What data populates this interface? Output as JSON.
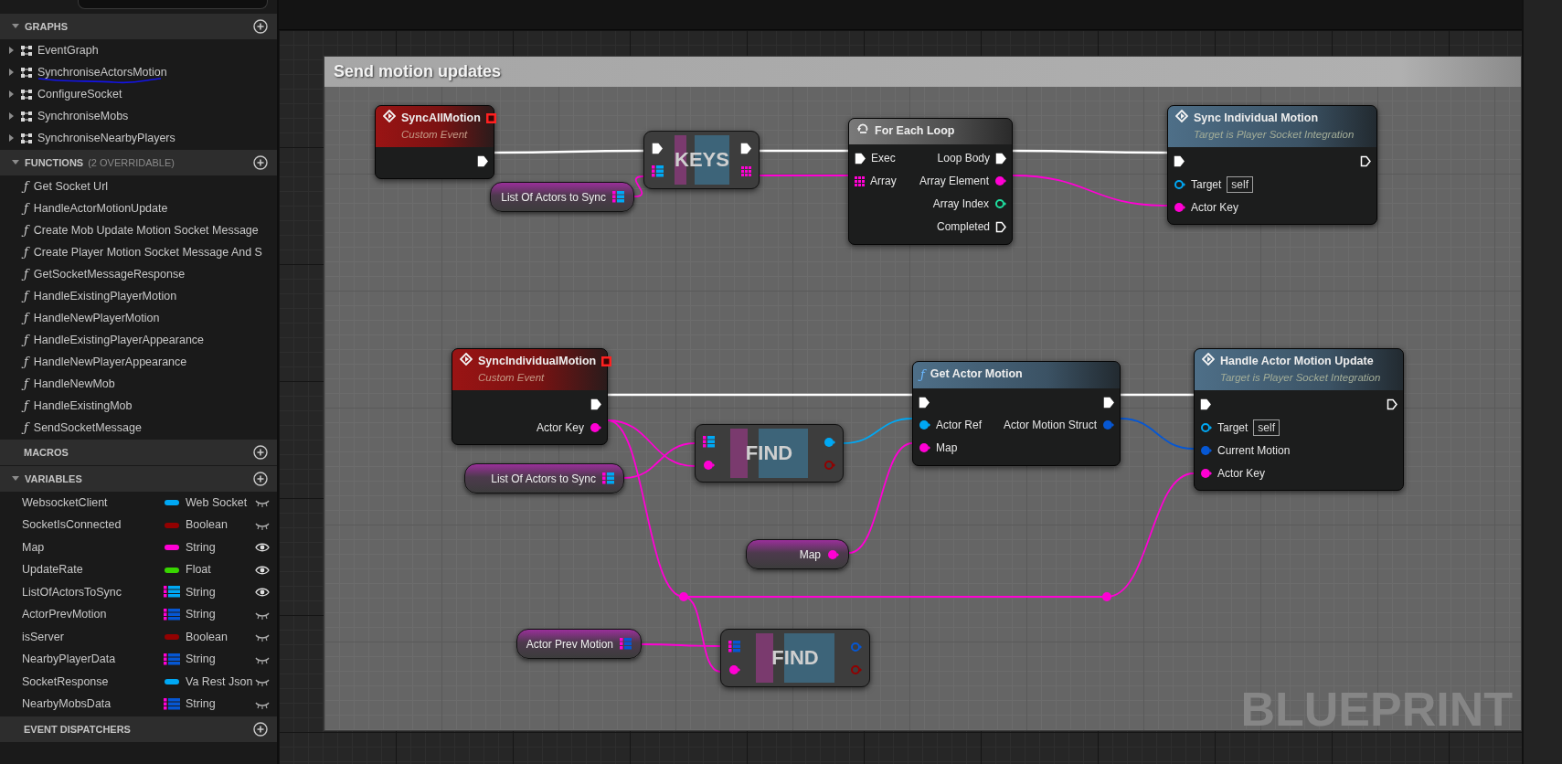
{
  "sidebar": {
    "sections": [
      {
        "kind": "graphs",
        "title": "GRAPHS",
        "expanded": true,
        "items": [
          {
            "label": "EventGraph",
            "expanded": false,
            "underlined": false
          },
          {
            "label": "SynchroniseActorsMotion",
            "expanded": false,
            "underlined": true
          },
          {
            "label": "ConfigureSocket",
            "expanded": false,
            "underlined": false
          },
          {
            "label": "SynchroniseMobs",
            "expanded": false,
            "underlined": false
          },
          {
            "label": "SynchroniseNearbyPlayers",
            "expanded": false,
            "underlined": false
          }
        ]
      },
      {
        "kind": "functions",
        "title": "FUNCTIONS",
        "note": "(2 OVERRIDABLE)",
        "expanded": true,
        "items": [
          {
            "icon": "ƒ",
            "label": "Get Socket Url"
          },
          {
            "icon": "ƒ",
            "label": "HandleActorMotionUpdate"
          },
          {
            "icon": "ƒ",
            "label": "Create Mob Update Motion Socket Message"
          },
          {
            "icon": "ƒ",
            "label": "Create Player Motion Socket Message And S"
          },
          {
            "icon": "ƒ",
            "label": "GetSocketMessageResponse"
          },
          {
            "icon": "ƒ",
            "label": "HandleExistingPlayerMotion"
          },
          {
            "icon": "ƒ",
            "label": "HandleNewPlayerMotion"
          },
          {
            "icon": "ƒ",
            "label": "HandleExistingPlayerAppearance"
          },
          {
            "icon": "ƒ",
            "label": "HandleNewPlayerAppearance"
          },
          {
            "icon": "ƒ",
            "label": "HandleNewMob"
          },
          {
            "icon": "ƒ",
            "label": "HandleExistingMob"
          },
          {
            "icon": "ƒ",
            "label": "SendSocketMessage"
          }
        ]
      },
      {
        "title": "MACROS"
      },
      {
        "kind": "variables",
        "title": "VARIABLES",
        "expanded": true,
        "items": [
          {
            "name": "WebsocketClient",
            "type": "Web Socket",
            "kind": "single",
            "color": "#00a8f4",
            "visible": false
          },
          {
            "name": "SocketIsConnected",
            "type": "Boolean",
            "kind": "single",
            "color": "#920101",
            "visible": false
          },
          {
            "name": "Map",
            "type": "String",
            "kind": "single",
            "color": "#ff00d4",
            "visible": true
          },
          {
            "name": "UpdateRate",
            "type": "Float",
            "kind": "single",
            "color": "#38d500",
            "visible": true
          },
          {
            "name": "ListOfActorsToSync",
            "type": "String",
            "kind": "map",
            "color": "#00a8f4",
            "visible": true
          },
          {
            "name": "ActorPrevMotion",
            "type": "String",
            "kind": "map",
            "color": "#0657d3",
            "visible": false
          },
          {
            "name": "isServer",
            "type": "Boolean",
            "kind": "single",
            "color": "#920101",
            "visible": false
          },
          {
            "name": "NearbyPlayerData",
            "type": "String",
            "kind": "map",
            "color": "#0657d3",
            "visible": false
          },
          {
            "name": "SocketResponse",
            "type": "Va Rest Json",
            "kind": "single",
            "color": "#00a8f4",
            "visible": false
          },
          {
            "name": "NearbyMobsData",
            "type": "String",
            "kind": "map",
            "color": "#0657d3",
            "visible": false
          }
        ]
      },
      {
        "title": "EVENT DISPATCHERS"
      }
    ]
  },
  "graph": {
    "comment": {
      "title": "Send motion updates"
    },
    "watermark": "BLUEPRINT",
    "nodes": [
      {
        "kind": "event",
        "title": "SyncAllMotion",
        "subtitle": "Custom Event",
        "header_pin": {
          "kind": "delegate",
          "color": "#ff2020",
          "linked": false
        },
        "outputs": [
          {
            "kind": "exec",
            "linked": true
          }
        ]
      },
      {
        "kind": "compact",
        "title": "KEYS",
        "inputs": [
          {
            "kind": "exec",
            "linked": true
          },
          {
            "kind": "map",
            "color": "#00a8f4",
            "linked": true
          }
        ],
        "outputs": [
          {
            "kind": "exec",
            "linked": true
          },
          {
            "kind": "array",
            "color": "#ff00d4",
            "linked": true
          }
        ]
      },
      {
        "kind": "variable",
        "title": "List Of Actors to Sync",
        "outputs": [
          {
            "kind": "map",
            "color": "#00a8f4",
            "linked": true
          }
        ]
      },
      {
        "kind": "macro",
        "title": "For Each Loop",
        "inputs": [
          {
            "kind": "exec",
            "label": "Exec",
            "linked": true
          },
          {
            "kind": "array",
            "label": "Array",
            "color": "#ff00d4",
            "linked": true
          }
        ],
        "outputs": [
          {
            "kind": "exec",
            "label": "Loop Body",
            "linked": true
          },
          {
            "kind": "data",
            "label": "Array Element",
            "color": "#ff00d4",
            "linked": true
          },
          {
            "kind": "data",
            "label": "Array Index",
            "color": "#1fe0a0",
            "linked": false
          },
          {
            "kind": "exec",
            "label": "Completed",
            "linked": false
          }
        ]
      },
      {
        "kind": "function",
        "title": "Sync Individual Motion",
        "subtitle": "Target is Player Socket Integration",
        "inputs": [
          {
            "kind": "exec",
            "linked": true
          },
          {
            "kind": "data",
            "label": "Target",
            "value": "self",
            "color": "#00a8f4",
            "linked": false
          },
          {
            "kind": "data",
            "label": "Actor Key",
            "color": "#ff00d4",
            "linked": true
          }
        ],
        "outputs": [
          {
            "kind": "exec",
            "linked": false
          }
        ]
      },
      {
        "kind": "event",
        "title": "SyncIndividualMotion",
        "subtitle": "Custom Event",
        "header_pin": {
          "kind": "delegate",
          "color": "#ff2020",
          "linked": false
        },
        "outputs": [
          {
            "kind": "exec",
            "linked": true
          },
          {
            "kind": "data",
            "label": "Actor Key",
            "color": "#ff00d4",
            "linked": true
          }
        ]
      },
      {
        "kind": "variable",
        "title": "List Of Actors to Sync",
        "outputs": [
          {
            "kind": "map",
            "color": "#00a8f4",
            "linked": true
          }
        ]
      },
      {
        "kind": "compact",
        "title": "FIND",
        "inputs": [
          {
            "kind": "map",
            "color": "#00a8f4",
            "linked": true
          },
          {
            "kind": "data",
            "color": "#ff00d4",
            "linked": true
          }
        ],
        "outputs": [
          {
            "kind": "data",
            "color": "#00a8f4",
            "linked": true
          },
          {
            "kind": "data",
            "color": "#920101",
            "linked": false
          }
        ]
      },
      {
        "kind": "function",
        "title": "Get Actor Motion",
        "glyph": "ƒ",
        "inputs": [
          {
            "kind": "exec",
            "linked": true
          },
          {
            "kind": "data",
            "label": "Actor Ref",
            "color": "#00a8f4",
            "linked": true
          },
          {
            "kind": "data",
            "label": "Map",
            "color": "#ff00d4",
            "linked": true
          }
        ],
        "outputs": [
          {
            "kind": "exec",
            "linked": true
          },
          {
            "kind": "data",
            "label": "Actor Motion Struct",
            "color": "#0657d3",
            "linked": true
          }
        ]
      },
      {
        "kind": "function",
        "title": "Handle Actor Motion Update",
        "subtitle": "Target is Player Socket Integration",
        "inputs": [
          {
            "kind": "exec",
            "linked": true
          },
          {
            "kind": "data",
            "label": "Target",
            "value": "self",
            "color": "#00a8f4",
            "linked": false
          },
          {
            "kind": "data",
            "label": "Current Motion",
            "color": "#0657d3",
            "linked": true
          },
          {
            "kind": "data",
            "label": "Actor Key",
            "color": "#ff00d4",
            "linked": true
          }
        ],
        "outputs": [
          {
            "kind": "exec",
            "linked": false
          }
        ]
      },
      {
        "kind": "variable",
        "title": "Map",
        "outputs": [
          {
            "kind": "data",
            "color": "#ff00d4",
            "linked": true
          }
        ]
      },
      {
        "kind": "variable",
        "title": "Actor Prev Motion",
        "outputs": [
          {
            "kind": "map",
            "color": "#0657d3",
            "linked": true
          }
        ]
      },
      {
        "kind": "compact",
        "title": "FIND",
        "inputs": [
          {
            "kind": "map",
            "color": "#0657d3",
            "linked": true
          },
          {
            "kind": "data",
            "color": "#ff00d4",
            "linked": true
          }
        ],
        "outputs": [
          {
            "kind": "data",
            "color": "#0657d3",
            "linked": false
          },
          {
            "kind": "data",
            "color": "#920101",
            "linked": false
          }
        ]
      }
    ]
  }
}
